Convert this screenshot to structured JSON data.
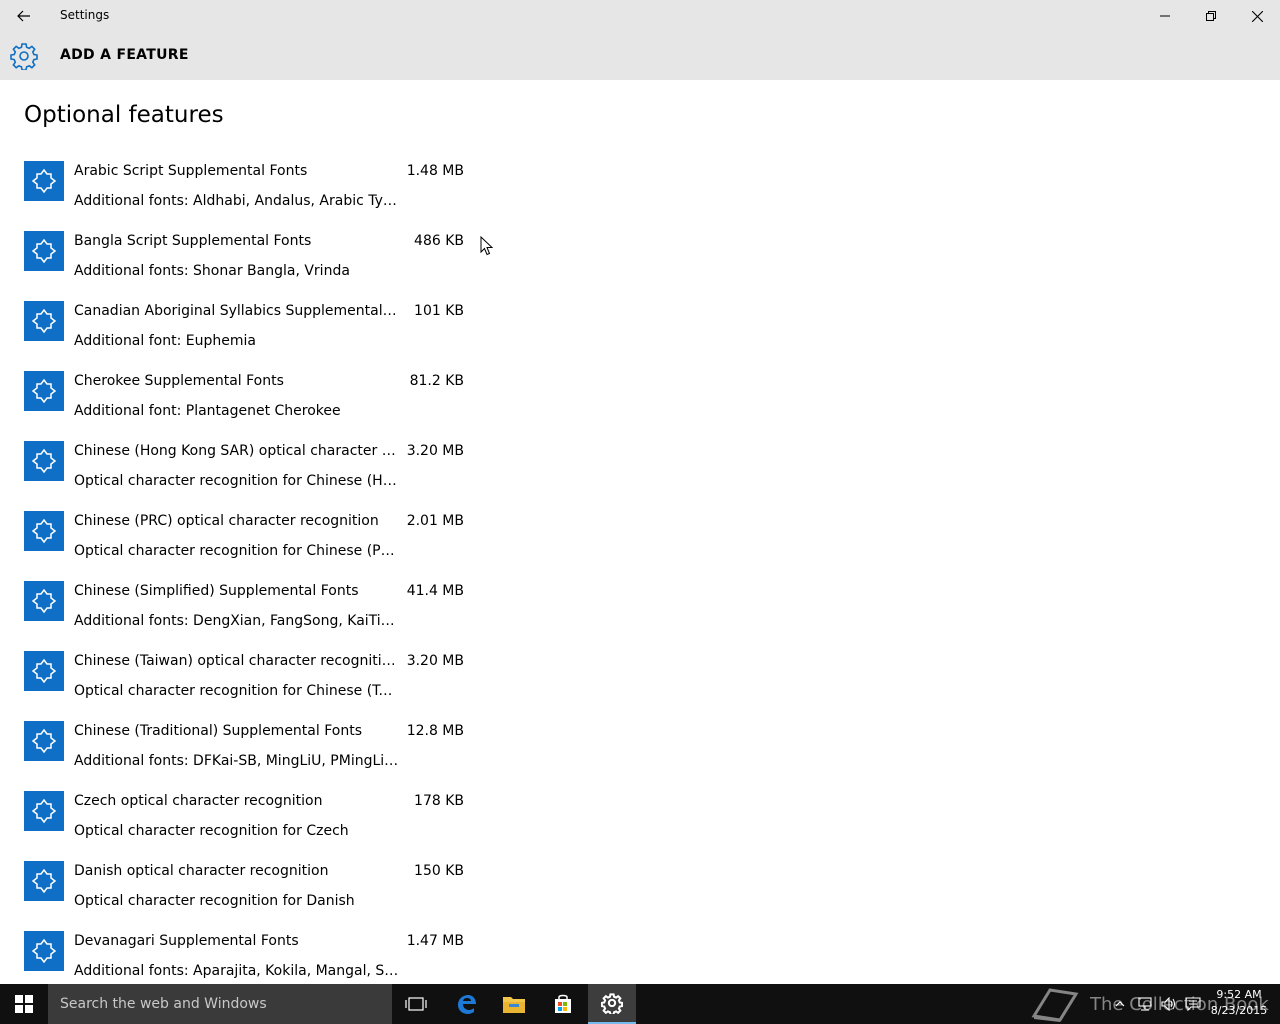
{
  "window": {
    "title": "Settings"
  },
  "header": {
    "title": "ADD A FEATURE"
  },
  "page": {
    "title": "Optional features"
  },
  "features": [
    {
      "name": "Arabic Script Supplemental Fonts",
      "size": "1.48 MB",
      "description": "Additional fonts: Aldhabi, Andalus, Arabic Type..."
    },
    {
      "name": "Bangla Script Supplemental Fonts",
      "size": "486 KB",
      "description": "Additional fonts: Shonar Bangla, Vrinda"
    },
    {
      "name": "Canadian Aboriginal Syllabics Supplemental Fonts",
      "size": "101 KB",
      "description": "Additional font: Euphemia"
    },
    {
      "name": "Cherokee Supplemental Fonts",
      "size": "81.2 KB",
      "description": "Additional font: Plantagenet Cherokee"
    },
    {
      "name": "Chinese (Hong Kong SAR) optical character rec...",
      "size": "3.20 MB",
      "description": "Optical character recognition for Chinese (Hon..."
    },
    {
      "name": "Chinese (PRC) optical character recognition",
      "size": "2.01 MB",
      "description": "Optical character recognition for Chinese (PRC)"
    },
    {
      "name": "Chinese (Simplified) Supplemental Fonts",
      "size": "41.4 MB",
      "description": "Additional fonts: DengXian, FangSong, KaiTi, Si..."
    },
    {
      "name": "Chinese (Taiwan) optical character recognition",
      "size": "3.20 MB",
      "description": "Optical character recognition for Chinese (Taiw..."
    },
    {
      "name": "Chinese (Traditional) Supplemental Fonts",
      "size": "12.8 MB",
      "description": "Additional fonts: DFKai-SB, MingLiU, PMingLiU,..."
    },
    {
      "name": "Czech optical character recognition",
      "size": "178 KB",
      "description": "Optical character recognition for Czech"
    },
    {
      "name": "Danish optical character recognition",
      "size": "150 KB",
      "description": "Optical character recognition for Danish"
    },
    {
      "name": "Devanagari Supplemental Fonts",
      "size": "1.47 MB",
      "description": "Additional fonts: Aparajita, Kokila, Mangal, Sans..."
    }
  ],
  "taskbar": {
    "search_placeholder": "Search the web and Windows",
    "clock_time": "9:52 AM",
    "clock_date": "8/23/2015",
    "watermark": "The Collection Book"
  },
  "colors": {
    "accent": "#0f6fc6",
    "chrome": "#e6e6e6",
    "taskbar": "#101010"
  }
}
